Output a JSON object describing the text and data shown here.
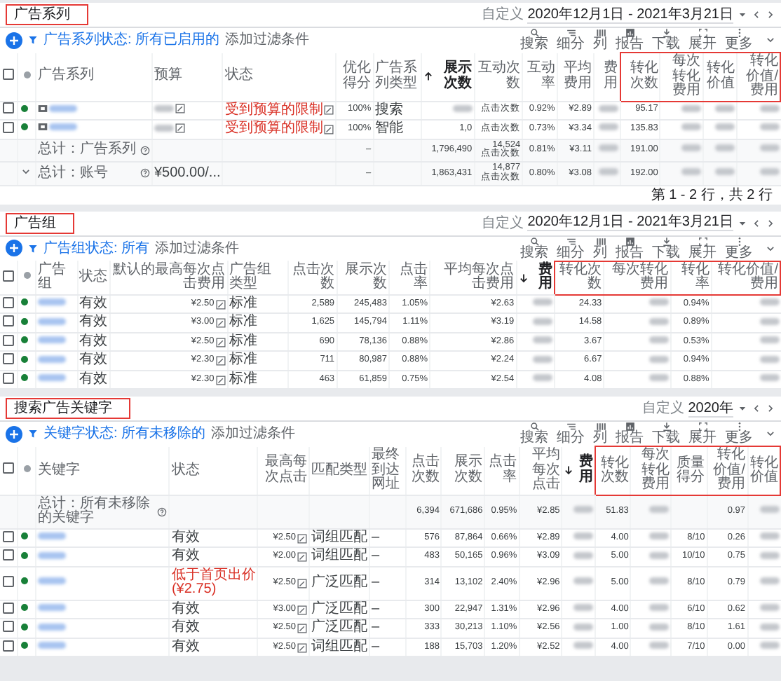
{
  "panels": [
    {
      "title": "广告系列",
      "date_label": "自定义",
      "date_range": "2020年12月1日 - 2021年3月21日",
      "filter_label": "广告系列状态: 所有已启用的",
      "add_filter": "添加过滤条件",
      "toolbar": [
        {
          "kind": "search",
          "label": "搜索"
        },
        {
          "kind": "segment",
          "label": "细分"
        },
        {
          "kind": "columns",
          "label": "列"
        },
        {
          "kind": "report",
          "label": "报告"
        },
        {
          "kind": "download",
          "label": "下载"
        },
        {
          "kind": "expand",
          "label": "展开"
        },
        {
          "kind": "more",
          "label": "更多"
        }
      ],
      "header_checked": false,
      "columns": [
        {
          "label": "广告系列",
          "kind": "name",
          "type_icon": true
        },
        {
          "label": "预算",
          "kind": "text",
          "edit": true
        },
        {
          "label": "状态",
          "kind": "text",
          "edit": true
        },
        {
          "label": "优化得分",
          "kind": "metric"
        },
        {
          "label": "广告系列类型",
          "kind": "text"
        },
        {
          "label": "展示次数",
          "kind": "metric",
          "sorted": true,
          "descending": false
        },
        {
          "label": "互动次数",
          "kind": "metric"
        },
        {
          "label": "互动率",
          "kind": "metric"
        },
        {
          "label": "平均费用",
          "kind": "metric"
        },
        {
          "label": "费用",
          "kind": "metric"
        },
        {
          "label": "转化次数",
          "kind": "metric",
          "highlighted": true
        },
        {
          "label": "每次转化费用",
          "kind": "metric",
          "highlighted": true
        },
        {
          "label": "转化价值",
          "kind": "metric",
          "highlighted": true
        },
        {
          "label": "转化价值/费用",
          "kind": "metric",
          "highlighted": true
        }
      ],
      "rows": [
        {
          "kind": "item",
          "checked": false,
          "cells": [
            {
              "kind": "redacted"
            },
            {
              "kind": "redacted"
            },
            {
              "kind": "warning",
              "text": "受到预算的限制"
            },
            "100%",
            "搜索",
            {
              "kind": "redacted"
            },
            "点击次数",
            "0.92%",
            "¥2.89",
            {
              "kind": "redacted"
            },
            "95.17",
            {
              "kind": "redacted"
            },
            {
              "kind": "redacted"
            },
            {
              "kind": "redacted"
            }
          ]
        },
        {
          "kind": "item",
          "checked": false,
          "cells": [
            {
              "kind": "redacted"
            },
            {
              "kind": "redacted"
            },
            {
              "kind": "warning",
              "text": "受到预算的限制"
            },
            "100%",
            "智能",
            "1,0",
            "点击次数",
            "0.73%",
            "¥3.34",
            {
              "kind": "redacted"
            },
            "135.83",
            {
              "kind": "redacted"
            },
            {
              "kind": "redacted"
            },
            {
              "kind": "redacted"
            }
          ]
        },
        {
          "kind": "total",
          "cells": [
            "总计：广告系列",
            null,
            null,
            "–",
            null,
            "1,796,490",
            "14,524\n点击次数",
            "0.81%",
            "¥3.11",
            {
              "kind": "redacted"
            },
            "191.00",
            {
              "kind": "redacted"
            },
            {
              "kind": "redacted"
            },
            {
              "kind": "redacted"
            }
          ]
        },
        {
          "kind": "total",
          "expandable": true,
          "cells": [
            "总计：账号",
            "¥500.00/...",
            null,
            "–",
            null,
            "1,863,431",
            "14,877\n点击次数",
            "0.80%",
            "¥3.08",
            {
              "kind": "redacted"
            },
            "192.00",
            {
              "kind": "redacted"
            },
            {
              "kind": "redacted"
            },
            {
              "kind": "redacted"
            }
          ]
        }
      ],
      "footer": "第 1 - 2 行，共 2 行"
    },
    {
      "title": "广告组",
      "date_label": "自定义",
      "date_range": "2020年12月1日 - 2021年3月21日",
      "filter_label": "广告组状态: 所有",
      "add_filter": "添加过滤条件",
      "toolbar": [
        {
          "kind": "search",
          "label": "搜索"
        },
        {
          "kind": "segment",
          "label": "细分"
        },
        {
          "kind": "columns",
          "label": "列"
        },
        {
          "kind": "report",
          "label": "报告"
        },
        {
          "kind": "download",
          "label": "下载"
        },
        {
          "kind": "expand",
          "label": "展开"
        },
        {
          "kind": "more",
          "label": "更多"
        }
      ],
      "header_checked": false,
      "columns": [
        {
          "label": "广告组",
          "kind": "name"
        },
        {
          "label": "状态",
          "kind": "text"
        },
        {
          "label": "默认的最高每次点击费用",
          "kind": "metric",
          "edit": true
        },
        {
          "label": "广告组类型",
          "kind": "text"
        },
        {
          "label": "点击次数",
          "kind": "metric"
        },
        {
          "label": "展示次数",
          "kind": "metric"
        },
        {
          "label": "点击率",
          "kind": "metric"
        },
        {
          "label": "平均每次点击费用",
          "kind": "metric"
        },
        {
          "label": "费用",
          "kind": "metric",
          "sorted": true,
          "descending": true
        },
        {
          "label": "转化次数",
          "kind": "metric",
          "highlighted": true
        },
        {
          "label": "每次转化费用",
          "kind": "metric",
          "highlighted": true
        },
        {
          "label": "转化率",
          "kind": "metric",
          "highlighted": true
        },
        {
          "label": "转化价值/费用",
          "kind": "metric",
          "highlighted": true
        }
      ],
      "rows": [
        {
          "kind": "item",
          "checked": false,
          "cells": [
            {
              "kind": "redacted"
            },
            "有效",
            "¥2.50",
            "标准",
            "2,589",
            "245,483",
            "1.05%",
            "¥2.63",
            {
              "kind": "redacted"
            },
            "24.33",
            {
              "kind": "redacted"
            },
            "0.94%",
            {
              "kind": "redacted"
            }
          ]
        },
        {
          "kind": "item",
          "checked": false,
          "cells": [
            {
              "kind": "redacted"
            },
            "有效",
            "¥3.00",
            "标准",
            "1,625",
            "145,794",
            "1.11%",
            "¥3.19",
            {
              "kind": "redacted"
            },
            "14.58",
            {
              "kind": "redacted"
            },
            "0.89%",
            {
              "kind": "redacted"
            }
          ]
        },
        {
          "kind": "item",
          "checked": false,
          "cells": [
            {
              "kind": "redacted"
            },
            "有效",
            "¥2.50",
            "标准",
            "690",
            "78,136",
            "0.88%",
            "¥2.86",
            {
              "kind": "redacted"
            },
            "3.67",
            {
              "kind": "redacted"
            },
            "0.53%",
            {
              "kind": "redacted"
            }
          ]
        },
        {
          "kind": "item",
          "checked": false,
          "cells": [
            {
              "kind": "redacted"
            },
            "有效",
            "¥2.30",
            "标准",
            "711",
            "80,987",
            "0.88%",
            "¥2.24",
            {
              "kind": "redacted"
            },
            "6.67",
            {
              "kind": "redacted"
            },
            "0.94%",
            {
              "kind": "redacted"
            }
          ]
        },
        {
          "kind": "item",
          "checked": false,
          "cells": [
            {
              "kind": "redacted"
            },
            "有效",
            "¥2.30",
            "标准",
            "463",
            "61,859",
            "0.75%",
            "¥2.54",
            {
              "kind": "redacted"
            },
            "4.08",
            {
              "kind": "redacted"
            },
            "0.88%",
            {
              "kind": "redacted"
            }
          ]
        }
      ]
    },
    {
      "title": "搜索广告关键字",
      "date_label": "自定义",
      "date_range": "2020年",
      "filter_label": "关键字状态: 所有未移除的",
      "add_filter": "添加过滤条件",
      "toolbar": [
        {
          "kind": "search",
          "label": "搜索"
        },
        {
          "kind": "segment",
          "label": "细分"
        },
        {
          "kind": "columns",
          "label": "列"
        },
        {
          "kind": "report",
          "label": "报告"
        },
        {
          "kind": "download",
          "label": "下载"
        },
        {
          "kind": "expand",
          "label": "展开"
        },
        {
          "kind": "more",
          "label": "更多"
        }
      ],
      "header_checked": false,
      "columns": [
        {
          "label": "关键字",
          "kind": "name"
        },
        {
          "label": "状态",
          "kind": "text"
        },
        {
          "label": "最高每次点击",
          "kind": "metric",
          "edit": true
        },
        {
          "label": "匹配类型",
          "kind": "text"
        },
        {
          "label": "最终到达网址",
          "kind": "text"
        },
        {
          "label": "点击次数",
          "kind": "metric"
        },
        {
          "label": "展示次数",
          "kind": "metric"
        },
        {
          "label": "点击率",
          "kind": "metric"
        },
        {
          "label": "平均每次点击",
          "kind": "metric"
        },
        {
          "label": "费用",
          "kind": "metric",
          "sorted": true,
          "descending": true
        },
        {
          "label": "转化次数",
          "kind": "metric",
          "highlighted": true
        },
        {
          "label": "每次转化费用",
          "kind": "metric",
          "highlighted": true
        },
        {
          "label": "质量得分",
          "kind": "metric",
          "highlighted": true
        },
        {
          "label": "转化价值/费用",
          "kind": "metric",
          "highlighted": true
        },
        {
          "label": "转化价值",
          "kind": "metric",
          "highlighted": true
        }
      ],
      "rows": [
        {
          "kind": "total",
          "cells": [
            "总计：所有未移除的关键字",
            null,
            null,
            null,
            null,
            "6,394",
            "671,686",
            "0.95%",
            "¥2.85",
            {
              "kind": "redacted"
            },
            "51.83",
            {
              "kind": "redacted"
            },
            null,
            "0.97",
            {
              "kind": "redacted"
            }
          ]
        },
        {
          "kind": "item",
          "checked": false,
          "cells": [
            {
              "kind": "redacted"
            },
            "有效",
            "¥2.50",
            "词组匹配",
            "–",
            "576",
            "87,864",
            "0.66%",
            "¥2.89",
            {
              "kind": "redacted"
            },
            "4.00",
            {
              "kind": "redacted"
            },
            "8/10",
            "0.26",
            {
              "kind": "redacted"
            }
          ]
        },
        {
          "kind": "item",
          "checked": false,
          "cells": [
            {
              "kind": "redacted"
            },
            "有效",
            "¥2.00",
            "词组匹配",
            "–",
            "483",
            "50,165",
            "0.96%",
            "¥3.09",
            {
              "kind": "redacted"
            },
            "5.00",
            {
              "kind": "redacted"
            },
            "10/10",
            "0.75",
            {
              "kind": "redacted"
            }
          ]
        },
        {
          "kind": "item",
          "checked": false,
          "cells": [
            {
              "kind": "redacted"
            },
            {
              "kind": "warning",
              "text": "低于首页出价\n(¥2.75)"
            },
            "¥2.50",
            "广泛匹配",
            "–",
            "314",
            "13,102",
            "2.40%",
            "¥2.96",
            {
              "kind": "redacted"
            },
            "5.00",
            {
              "kind": "redacted"
            },
            "8/10",
            "0.79",
            {
              "kind": "redacted"
            }
          ]
        },
        {
          "kind": "item",
          "checked": false,
          "cells": [
            {
              "kind": "redacted"
            },
            "有效",
            "¥3.00",
            "广泛匹配",
            "–",
            "300",
            "22,947",
            "1.31%",
            "¥2.96",
            {
              "kind": "redacted"
            },
            "4.00",
            {
              "kind": "redacted"
            },
            "6/10",
            "0.62",
            {
              "kind": "redacted"
            }
          ]
        },
        {
          "kind": "item",
          "checked": false,
          "cells": [
            {
              "kind": "redacted"
            },
            "有效",
            "¥2.50",
            "广泛匹配",
            "–",
            "333",
            "30,213",
            "1.10%",
            "¥2.56",
            {
              "kind": "redacted"
            },
            "1.00",
            {
              "kind": "redacted"
            },
            "8/10",
            "1.61",
            {
              "kind": "redacted"
            }
          ]
        },
        {
          "kind": "item",
          "checked": false,
          "cells": [
            {
              "kind": "redacted"
            },
            "有效",
            "¥2.50",
            "词组匹配",
            "–",
            "188",
            "15,703",
            "1.20%",
            "¥2.52",
            {
              "kind": "redacted"
            },
            "4.00",
            {
              "kind": "redacted"
            },
            "7/10",
            "0.00",
            {
              "kind": "redacted"
            }
          ]
        }
      ]
    }
  ]
}
